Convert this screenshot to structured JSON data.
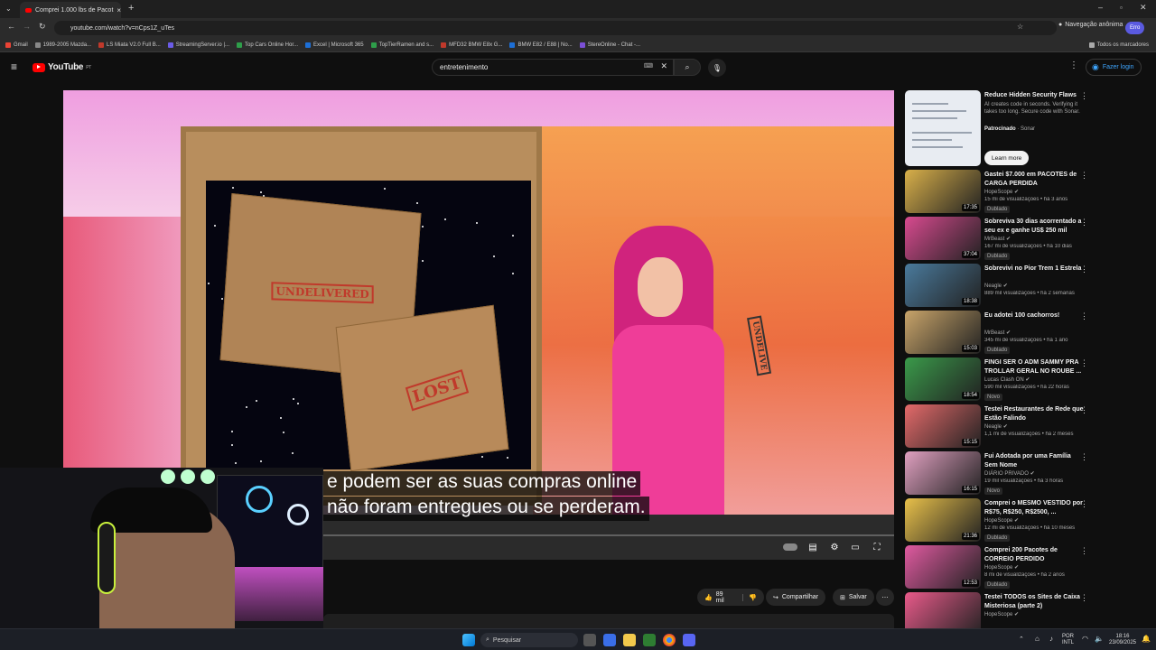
{
  "browser": {
    "tab_title": "Comprei 1.000 lbs de Pacot",
    "url": "youtube.com/watch?v=nCps1Z_uTes",
    "incognito_label": "Navegação anônima",
    "profile_label": "Erro",
    "bookmarks": [
      "Gmail",
      "1989-2005 Mazda...",
      "LS Miata V2.0 Full B...",
      "StreamingServer.io |...",
      "Top Cars Online Hor...",
      "Excel | Microsoft 365",
      "TopTierRamen and s...",
      "MFD32 BMW E8x G...",
      "BMW E82 / E88 | No...",
      "StereOnline - Chat -..."
    ],
    "bookmarks_folder": "Todos os marcadores"
  },
  "youtube": {
    "logo_text": "YouTube",
    "logo_region": "PT",
    "search_value": "entretenimento",
    "login_label": "Fazer login"
  },
  "video": {
    "caption_line1": "e podem ser as suas compras online",
    "caption_line2": "não foram entregues ou se perderam.",
    "stamp1": "UNDELIVERED",
    "stamp2": "LOST",
    "stamp3": "UNDELIVE"
  },
  "actions": {
    "likes": "89 mil",
    "share": "Compartilhar",
    "save": "Salvar"
  },
  "sidebar": {
    "ad": {
      "title": "Reduce Hidden Security Flaws",
      "desc": "AI creates code in seconds. Verifying it takes too long. Secure code with Sonar.",
      "sponsored": "Patrocinado",
      "advertiser": "Sonar",
      "cta": "Learn more"
    },
    "items": [
      {
        "title": "Gastei $7.000 em PACOTES de CARGA PERDIDA",
        "channel": "HopeScope",
        "meta": "15 mi de visualizações • há 3 anos",
        "badge": "Dublado",
        "duration": "17:35",
        "thumb_color": "#d9b04a"
      },
      {
        "title": "Sobreviva 30 dias acorrentado a seu ex e ganhe US$ 250 mil",
        "channel": "MrBeast",
        "meta": "167 mi de visualizações • há 10 dias",
        "badge": "Dublado",
        "duration": "37:04",
        "thumb_color": "#d84a8f"
      },
      {
        "title": "Sobrevivi no Pior Trem 1 Estrela",
        "channel": "Neagle",
        "meta": "889 mil visualizações • há 2 semanas",
        "badge": "",
        "duration": "18:38",
        "thumb_color": "#4a7a9c"
      },
      {
        "title": "Eu adotei 100 cachorros!",
        "channel": "MrBeast",
        "meta": "345 mi de visualizações • há 1 ano",
        "badge": "Dublado",
        "duration": "15:03",
        "thumb_color": "#c9a56a"
      },
      {
        "title": "FINGI SER O ADM SAMMY PRA TROLLAR GERAL NO ROUBE ...",
        "channel": "Lucas Clash ON",
        "meta": "590 mil visualizações • há 22 horas",
        "badge": "Novo",
        "duration": "18:54",
        "thumb_color": "#3a9a4a"
      },
      {
        "title": "Testei Restaurantes de Rede que Estão Falindo",
        "channel": "Neagle",
        "meta": "1,1 mi de visualizações • há 2 meses",
        "badge": "",
        "duration": "15:15",
        "thumb_color": "#e46a6a"
      },
      {
        "title": "Fui Adotada por uma Família Sem Nome",
        "channel": "DIÁRIO PRIVADO",
        "meta": "19 mil visualizações • há 3 horas",
        "badge": "Novo",
        "duration": "16:15",
        "thumb_color": "#e0a0c0"
      },
      {
        "title": "Comprei o MESMO VESTIDO por R$75, R$250, R$2500, ...",
        "channel": "HopeScope",
        "meta": "12 mi de visualizações • há 10 meses",
        "badge": "Dublado",
        "duration": "21:36",
        "thumb_color": "#e8c04a"
      },
      {
        "title": "Comprei 200 Pacotes de CORREIO PERDIDO",
        "channel": "HopeScope",
        "meta": "8 mi de visualizações • há 2 anos",
        "badge": "Dublado",
        "duration": "12:53",
        "thumb_color": "#e05aa0"
      },
      {
        "title": "Testei TODOS os Sites de Caixa Misteriosa (parte 2)",
        "channel": "HopeScope",
        "meta": "",
        "badge": "",
        "duration": "",
        "thumb_color": "#e85a8a"
      }
    ]
  },
  "taskbar": {
    "search_placeholder": "Pesquisar",
    "lang_top": "POR",
    "lang_bottom": "INTL",
    "time": "18:16",
    "date": "23/09/2025"
  }
}
